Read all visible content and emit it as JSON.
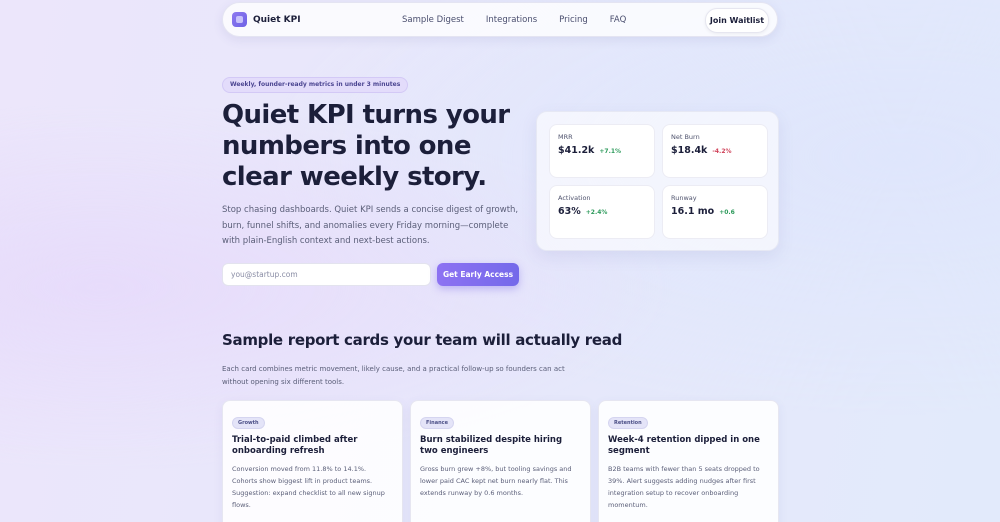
{
  "nav": {
    "brand": "Quiet KPI",
    "links": [
      "Sample Digest",
      "Integrations",
      "Pricing",
      "FAQ"
    ],
    "cta": "Join Waitlist"
  },
  "hero": {
    "eyebrow": "Weekly, founder-ready metrics in under 3 minutes",
    "title": "Quiet KPI turns your numbers into one clear weekly story.",
    "subtitle": "Stop chasing dashboards. Quiet KPI sends a concise digest of growth, burn, funnel shifts, and anomalies every Friday morning—complete with plain-English context and next-best actions.",
    "email_placeholder": "you@startup.com",
    "email_value": "",
    "cta": "Get Early Access"
  },
  "metrics": [
    {
      "label": "MRR",
      "value": "$41.2k",
      "delta": "+7.1%",
      "trend": "up"
    },
    {
      "label": "Net Burn",
      "value": "$18.4k",
      "delta": "-4.2%",
      "trend": "down"
    },
    {
      "label": "Activation",
      "value": "63%",
      "delta": "+2.4%",
      "trend": "up"
    },
    {
      "label": "Runway",
      "value": "16.1 mo",
      "delta": "+0.6",
      "trend": "up"
    }
  ],
  "section": {
    "title": "Sample report cards your team will actually read",
    "subtitle": "Each card combines metric movement, likely cause, and a practical follow-up so founders can act without opening six different tools."
  },
  "cards": [
    {
      "tag": "Growth",
      "title": "Trial-to-paid climbed after onboarding refresh",
      "body": "Conversion moved from 11.8% to 14.1%. Cohorts show biggest lift in product teams. Suggestion: expand checklist to all new signup flows."
    },
    {
      "tag": "Finance",
      "title": "Burn stabilized despite hiring two engineers",
      "body": "Gross burn grew +8%, but tooling savings and lower paid CAC kept net burn nearly flat. This extends runway by 0.6 months."
    },
    {
      "tag": "Retention",
      "title": "Week-4 retention dipped in one segment",
      "body": "B2B teams with fewer than 5 seats dropped to 39%. Alert suggests adding nudges after first integration setup to recover onboarding momentum."
    }
  ],
  "colors": {
    "accent": "#7b6cee",
    "positive": "#2d9a5b",
    "negative": "#d0435a",
    "text": "#1c1f3a"
  }
}
